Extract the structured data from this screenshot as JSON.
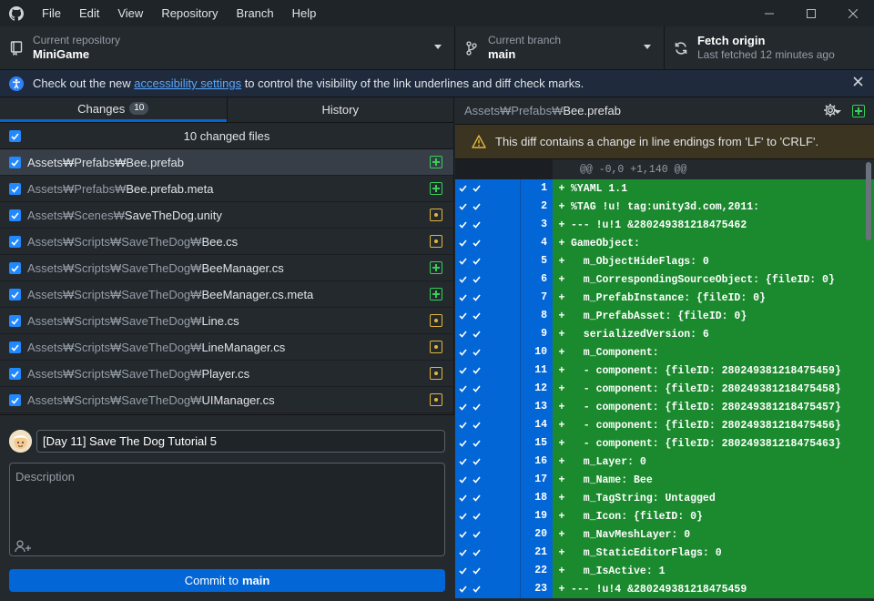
{
  "menu": [
    "File",
    "Edit",
    "View",
    "Repository",
    "Branch",
    "Help"
  ],
  "toolbar": {
    "repo_label": "Current repository",
    "repo_value": "MiniGame",
    "branch_label": "Current branch",
    "branch_value": "main",
    "fetch_label": "Fetch origin",
    "fetch_sub": "Last fetched 12 minutes ago"
  },
  "banner": {
    "before": "Check out the new ",
    "link": "accessibility settings",
    "after": " to control the visibility of the link underlines and diff check marks."
  },
  "tabs": {
    "changes": "Changes",
    "changes_count": "10",
    "history": "History"
  },
  "changed_files_label": "10 changed files",
  "files": [
    {
      "dir": "Assets₩Prefabs₩",
      "name": "Bee.prefab",
      "status": "added",
      "selected": true
    },
    {
      "dir": "Assets₩Prefabs₩",
      "name": "Bee.prefab.meta",
      "status": "added",
      "selected": false
    },
    {
      "dir": "Assets₩Scenes₩",
      "name": "SaveTheDog.unity",
      "status": "modified",
      "selected": false
    },
    {
      "dir": "Assets₩Scripts₩SaveTheDog₩",
      "name": "Bee.cs",
      "status": "modified",
      "selected": false
    },
    {
      "dir": "Assets₩Scripts₩SaveTheDog₩",
      "name": "BeeManager.cs",
      "status": "added",
      "selected": false
    },
    {
      "dir": "Assets₩Scripts₩SaveTheDog₩",
      "name": "BeeManager.cs.meta",
      "status": "added",
      "selected": false
    },
    {
      "dir": "Assets₩Scripts₩SaveTheDog₩",
      "name": "Line.cs",
      "status": "modified",
      "selected": false
    },
    {
      "dir": "Assets₩Scripts₩SaveTheDog₩",
      "name": "LineManager.cs",
      "status": "modified",
      "selected": false
    },
    {
      "dir": "Assets₩Scripts₩SaveTheDog₩",
      "name": "Player.cs",
      "status": "modified",
      "selected": false
    },
    {
      "dir": "Assets₩Scripts₩SaveTheDog₩",
      "name": "UIManager.cs",
      "status": "modified",
      "selected": false
    }
  ],
  "commit": {
    "summary_value": "[Day 11] Save The Dog Tutorial 5",
    "description_placeholder": "Description",
    "button_prefix": "Commit to",
    "button_branch": "main"
  },
  "diff": {
    "path_dir": "Assets₩Prefabs₩",
    "path_name": "Bee.prefab",
    "warning": "This diff contains a change in line endings from 'LF' to 'CRLF'.",
    "hunk": "@@ -0,0 +1,140 @@",
    "lines": [
      {
        "n": "1",
        "code": "%YAML 1.1"
      },
      {
        "n": "2",
        "code": "%TAG !u! tag:unity3d.com,2011:"
      },
      {
        "n": "3",
        "code": "--- !u!1 &280249381218475462"
      },
      {
        "n": "4",
        "code": "GameObject:"
      },
      {
        "n": "5",
        "code": "  m_ObjectHideFlags: 0"
      },
      {
        "n": "6",
        "code": "  m_CorrespondingSourceObject: {fileID: 0}"
      },
      {
        "n": "7",
        "code": "  m_PrefabInstance: {fileID: 0}"
      },
      {
        "n": "8",
        "code": "  m_PrefabAsset: {fileID: 0}"
      },
      {
        "n": "9",
        "code": "  serializedVersion: 6"
      },
      {
        "n": "10",
        "code": "  m_Component:"
      },
      {
        "n": "11",
        "code": "  - component: {fileID: 280249381218475459}"
      },
      {
        "n": "12",
        "code": "  - component: {fileID: 280249381218475458}"
      },
      {
        "n": "13",
        "code": "  - component: {fileID: 280249381218475457}"
      },
      {
        "n": "14",
        "code": "  - component: {fileID: 280249381218475456}"
      },
      {
        "n": "15",
        "code": "  - component: {fileID: 280249381218475463}"
      },
      {
        "n": "16",
        "code": "  m_Layer: 0"
      },
      {
        "n": "17",
        "code": "  m_Name: Bee"
      },
      {
        "n": "18",
        "code": "  m_TagString: Untagged"
      },
      {
        "n": "19",
        "code": "  m_Icon: {fileID: 0}"
      },
      {
        "n": "20",
        "code": "  m_NavMeshLayer: 0"
      },
      {
        "n": "21",
        "code": "  m_StaticEditorFlags: 0"
      },
      {
        "n": "22",
        "code": "  m_IsActive: 1"
      },
      {
        "n": "23",
        "code": "--- !u!4 &280249381218475459"
      }
    ]
  },
  "colors": {
    "accent": "#0366d6",
    "added": "#34d058",
    "modified": "#e0b73c",
    "diff_added_bg": "#1b8a2e"
  }
}
